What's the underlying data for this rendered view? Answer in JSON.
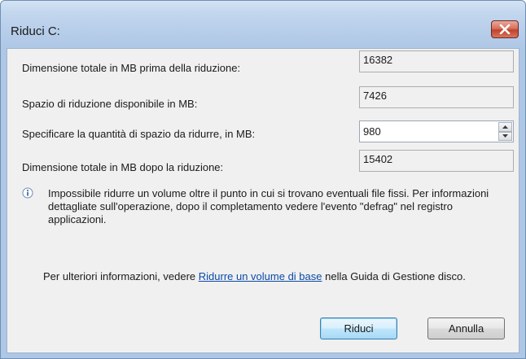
{
  "window": {
    "title": "Riduci C:",
    "close_icon": "close-icon"
  },
  "fields": {
    "total_before_label": "Dimensione totale in MB prima della riduzione:",
    "total_before_value": "16382",
    "available_label": "Spazio di riduzione disponibile in MB:",
    "available_value": "7426",
    "amount_label": "Specificare la quantità di spazio da ridurre, in MB:",
    "amount_value": "980",
    "total_after_label": "Dimensione totale in MB dopo la riduzione:",
    "total_after_value": "15402"
  },
  "info": {
    "icon": "info-icon",
    "text": "Impossibile ridurre un volume oltre il punto in cui si trovano eventuali file fissi. Per informazioni dettagliate sull'operazione, dopo il completamento vedere l'evento \"defrag\" nel registro applicazioni."
  },
  "more_info": {
    "prefix": "Per ulteriori informazioni, vedere ",
    "link": "Ridurre un volume di base",
    "suffix": " nella Guida di Gestione disco."
  },
  "buttons": {
    "shrink": "Riduci",
    "cancel": "Annulla"
  },
  "colors": {
    "link": "#0b4aa8",
    "close_button": "#c0422b",
    "default_button_border": "#3c7fb1"
  }
}
